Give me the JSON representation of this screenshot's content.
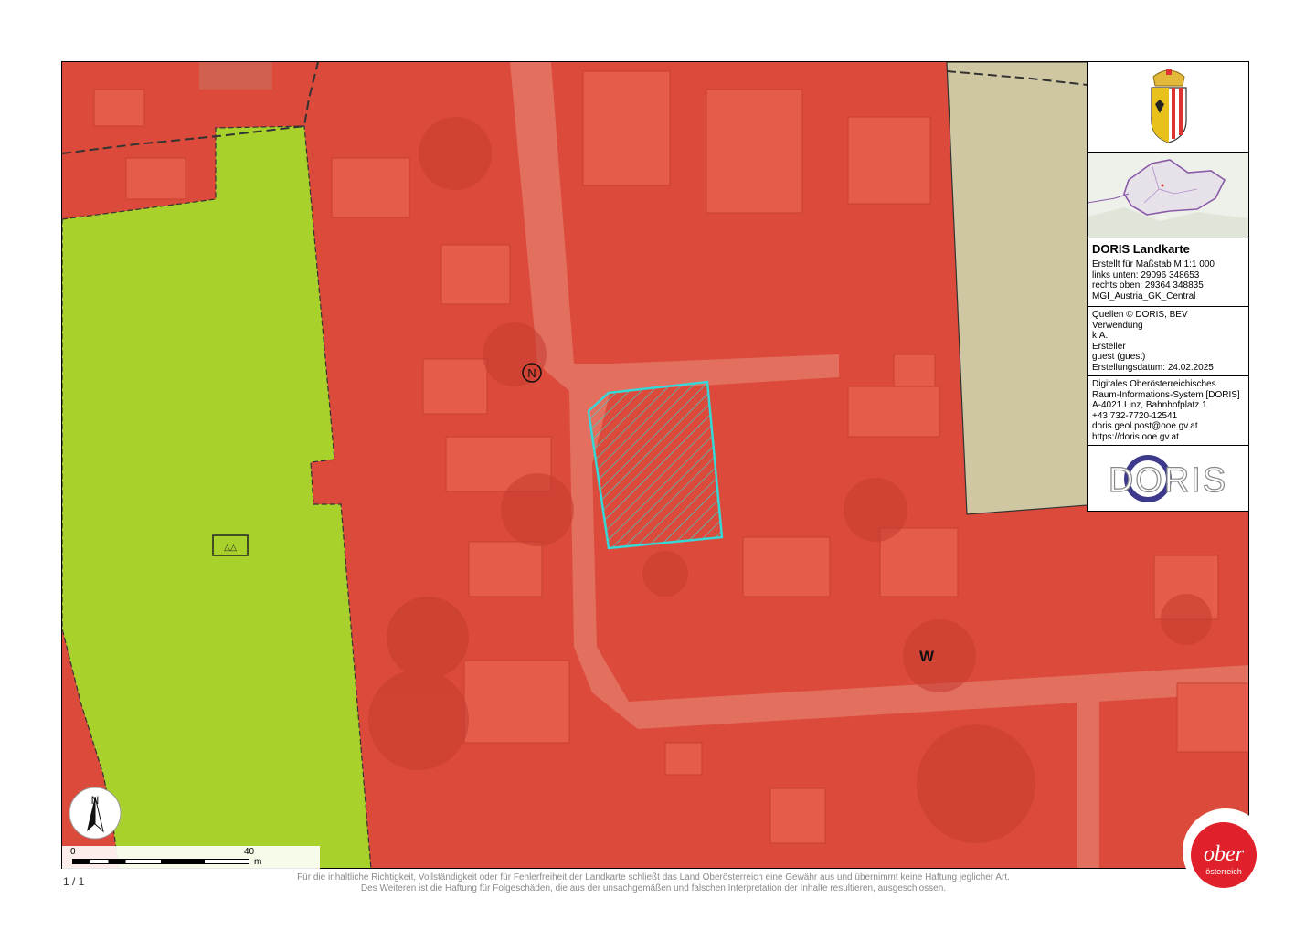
{
  "map": {
    "label_w": "W",
    "label_n_circle": "N",
    "north_arrow_label": "N",
    "colors": {
      "residential_red": "#dc4a3b",
      "green_zone": "#a9d12b",
      "beige_zone": "#cfc7a2",
      "parcel_outline": "#39d6d6"
    }
  },
  "scale_bar": {
    "start": "0",
    "end": "40",
    "unit": "m"
  },
  "panel": {
    "title": "DORIS Landkarte",
    "info": [
      "Erstellt für Maßstab M 1:1 000",
      "links unten: 29096 348653",
      "rechts oben: 29364 348835",
      "MGI_Austria_GK_Central"
    ],
    "meta": [
      "Quellen © DORIS, BEV",
      "Verwendung",
      "k.A.",
      "Ersteller",
      "guest (guest)",
      "Erstellungsdatum: 24.02.2025"
    ],
    "contact": [
      "Digitales Oberösterreichisches",
      "Raum-Informations-System [DORIS]",
      "A-4021 Linz, Bahnhofplatz 1",
      "+43 732-7720-12541",
      "doris.geol.post@ooe.gv.at",
      "https://doris.ooe.gv.at"
    ],
    "logo_text": "DORIS"
  },
  "footer": {
    "page": "1 / 1",
    "disclaimer_1": "Für die inhaltliche Richtigkeit, Vollständigkeit oder für Fehlerfreiheit der Landkarte schließt das Land Oberösterreich eine Gewähr aus und übernimmt keine Haftung jeglicher Art.",
    "disclaimer_2": "Des Weiteren ist die Haftung für Folgeschäden, die aus der unsachgemäßen und falschen Interpretation der Inhalte resultieren, ausgeschlossen."
  },
  "brand": {
    "line1": "ober",
    "line2": "österreich"
  }
}
